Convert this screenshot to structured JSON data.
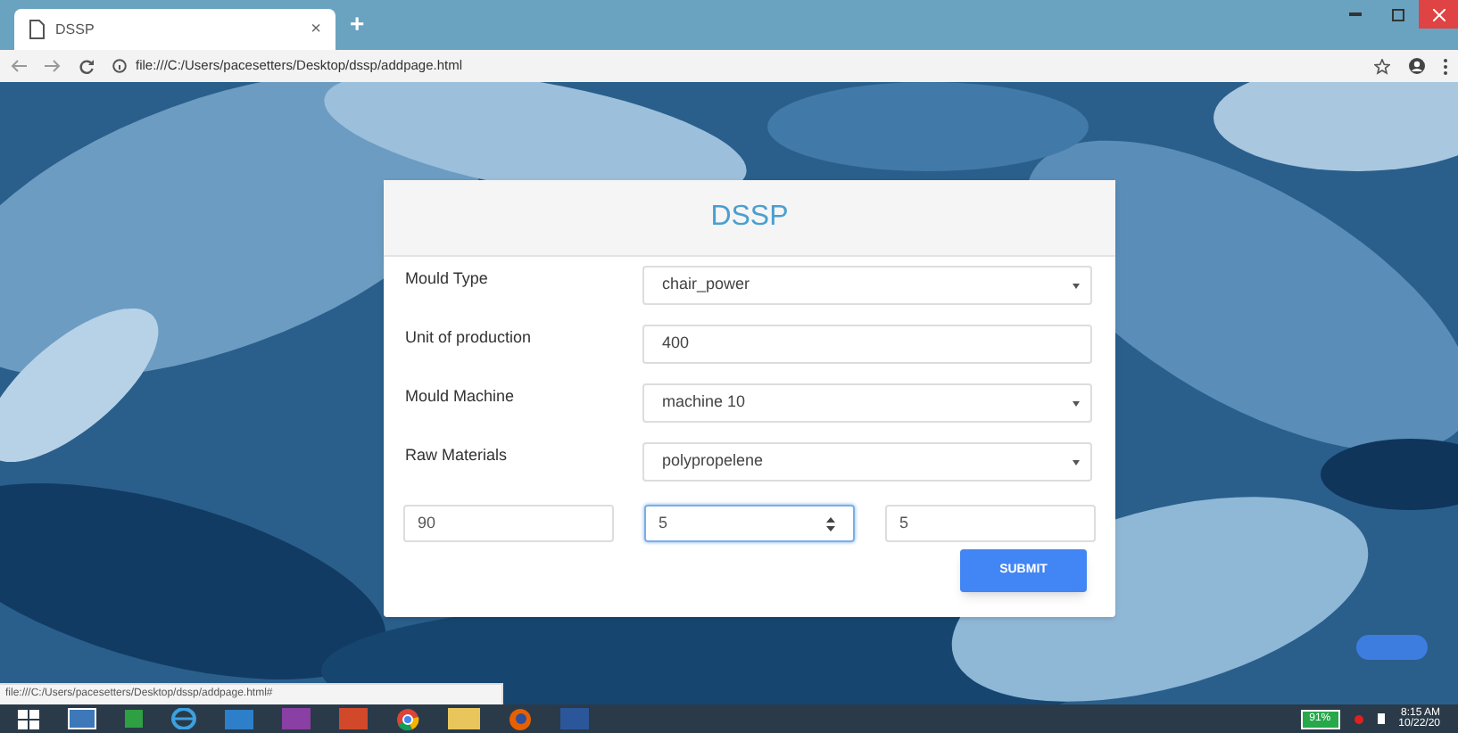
{
  "browser": {
    "tab": {
      "title": "DSSP",
      "close": "×"
    },
    "new_tab": "+",
    "url": "file:///C:/Users/pacesetters/Desktop/dssp/addpage.html"
  },
  "form": {
    "title": "DSSP",
    "fields": [
      {
        "label": "Mould Type",
        "kind": "select",
        "value": "chair_power"
      },
      {
        "label": "Unit of production",
        "kind": "text",
        "value": "400"
      },
      {
        "label": "Mould Machine",
        "kind": "select",
        "value": "machine 10"
      },
      {
        "label": "Raw Materials",
        "kind": "select",
        "value": "polypropelene"
      }
    ],
    "extra_inputs": [
      {
        "kind": "text",
        "value": "90",
        "focused": false
      },
      {
        "kind": "number",
        "value": "5",
        "focused": true
      },
      {
        "kind": "text",
        "value": "5",
        "focused": false
      }
    ],
    "submit": "SUBMIT"
  },
  "status_url": "file:///C:/Users/pacesetters/Desktop/dssp/addpage.html#",
  "taskbar": {
    "battery": "91%",
    "time": "8:15 AM",
    "date": "10/22/20"
  }
}
